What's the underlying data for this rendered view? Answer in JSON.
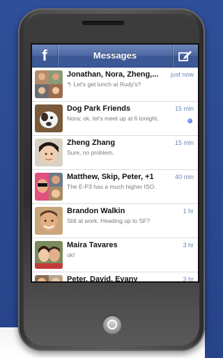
{
  "header": {
    "title": "Messages",
    "logo_letter": "f",
    "compose_icon": "compose-icon"
  },
  "threads": [
    {
      "name": "Jonathan, Nora, Zheng,...",
      "time": "just now",
      "snippet": "↰ Let's get lunch at Rudy's?",
      "avatar_type": "group",
      "unread": false
    },
    {
      "name": "Dog Park Friends",
      "time": "15 min",
      "snippet": "Nora: ok, let's meet up at 6 tonight.",
      "avatar_type": "dog",
      "unread": true
    },
    {
      "name": "Zheng Zhang",
      "time": "15 min",
      "snippet": "Sure, no problem.",
      "avatar_type": "person",
      "unread": false
    },
    {
      "name": "Matthew, Skip, Peter, +1",
      "time": "40 min",
      "snippet": "The E-P3 has a much higher ISO.",
      "avatar_type": "group",
      "unread": false
    },
    {
      "name": "Brandon Walkin",
      "time": "1 hr",
      "snippet": "Still at work. Heading up to SF?",
      "avatar_type": "person",
      "unread": false
    },
    {
      "name": "Maira Tavares",
      "time": "3 hr",
      "snippet": "ok!",
      "avatar_type": "person",
      "unread": false
    },
    {
      "name": "Peter, David, Evany",
      "time": "3 hr",
      "snippet": "",
      "avatar_type": "group",
      "unread": false
    }
  ],
  "colors": {
    "facebook_blue": "#3b5998",
    "time_blue": "#6c84b8",
    "background_blue": "#2f4f9a"
  }
}
